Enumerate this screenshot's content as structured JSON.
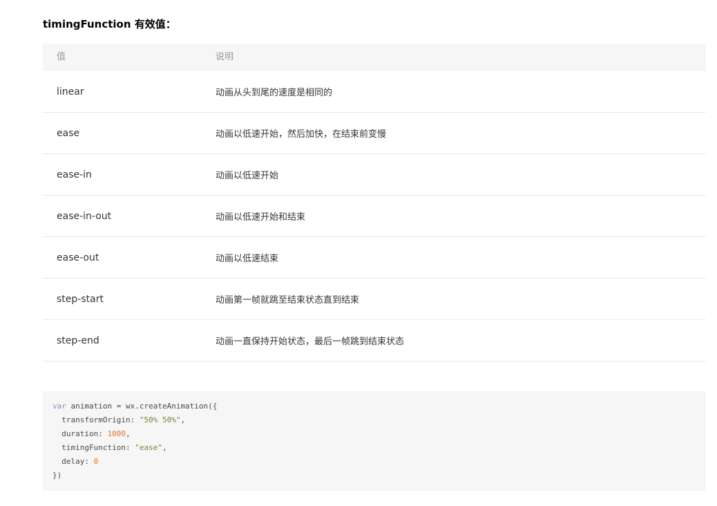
{
  "heading": "timingFunction 有效值：",
  "table": {
    "headers": [
      "值",
      "说明"
    ],
    "rows": [
      {
        "name": "linear",
        "desc": "动画从头到尾的速度是相同的"
      },
      {
        "name": "ease",
        "desc": "动画以低速开始，然后加快，在结束前变慢"
      },
      {
        "name": "ease-in",
        "desc": "动画以低速开始"
      },
      {
        "name": "ease-in-out",
        "desc": "动画以低速开始和结束"
      },
      {
        "name": "ease-out",
        "desc": "动画以低速结束"
      },
      {
        "name": "step-start",
        "desc": "动画第一帧就跳至结束状态直到结束"
      },
      {
        "name": "step-end",
        "desc": "动画一直保持开始状态，最后一帧跳到结束状态"
      }
    ]
  },
  "code": {
    "line1_kw": "var",
    "line1_rest": " animation = wx.createAnimation({",
    "line2_key": "  transformOrigin: ",
    "line2_val": "\"50% 50%\"",
    "line2_end": ",",
    "line3_key": "  duration: ",
    "line3_val": "1000",
    "line3_end": ",",
    "line4_key": "  timingFunction: ",
    "line4_val": "\"ease\"",
    "line4_end": ",",
    "line5_key": "  delay: ",
    "line5_val": "0",
    "line6": "})"
  },
  "colors": {
    "header_bg": "#f6f6f6",
    "code_bg": "#f6f6f6",
    "string": "#6e8a2f",
    "number": "#e5712e",
    "keyword": "#8a8fb8"
  }
}
